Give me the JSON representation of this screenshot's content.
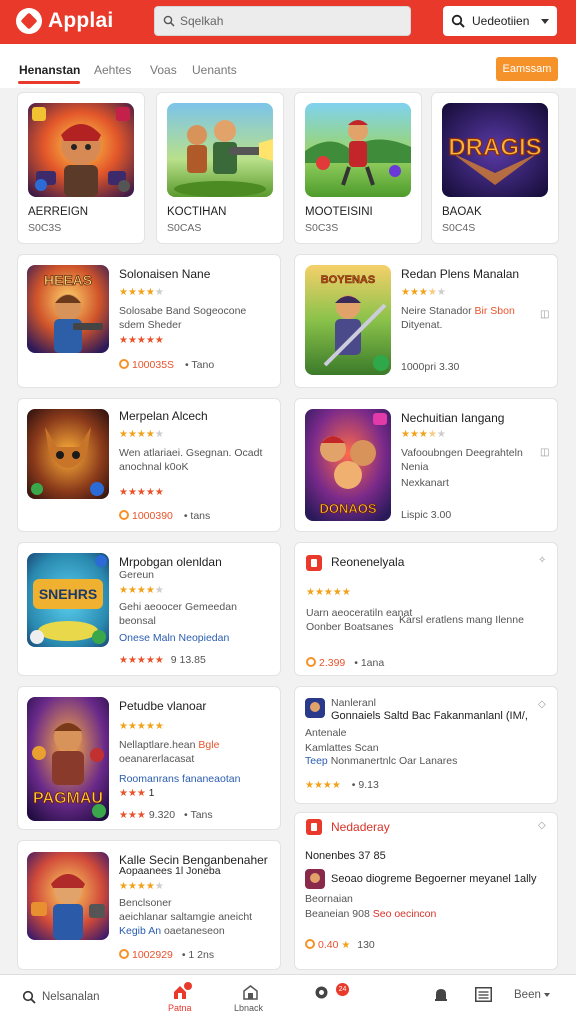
{
  "header": {
    "app_name": "Applai",
    "search_placeholder": "Sqelkah",
    "dropdown_label": "Uedeotiien"
  },
  "tabs": [
    {
      "label": "Henanstan",
      "active": true
    },
    {
      "label": "Aehtes"
    },
    {
      "label": "Voas"
    },
    {
      "label": "Uenants"
    }
  ],
  "tabs_button_label": "Eamssam",
  "featured": [
    {
      "title": "AERREIGN",
      "subtitle": "S0C3S",
      "thumb": "hero-warrior-game-art"
    },
    {
      "title": "KOCTIHAN",
      "subtitle": "S0CAS",
      "thumb": "soldiers-battle-game-art"
    },
    {
      "title": "MOOTEISINI",
      "subtitle": "S0C3S",
      "thumb": "archer-field-game-art"
    },
    {
      "title": "BAOAK",
      "subtitle": "S0C4S",
      "thumb": "dragons-logo-game-art",
      "logo_text": "DRAGIS"
    }
  ],
  "list": [
    {
      "title": "Solonaisen Nane",
      "rating": 4,
      "desc": [
        "Solosabe Band Sogeocone",
        "sdem Sheder"
      ],
      "sub_rating": 5,
      "price": "100035S",
      "price_suffix": "Tano",
      "thumb": "hero-gunner-game-art",
      "logo_text": "HEEAS"
    },
    {
      "title": "Redan Plens Manalan",
      "rating": 3.5,
      "desc": [
        "Neire Stanador",
        "Dityenat."
      ],
      "desc_accent": "Bir Sbon",
      "price": "1000pri",
      "price_suffix": "3.30",
      "thumb": "knight-sword-game-art",
      "logo_text": "BOYENAS"
    },
    {
      "title": "Merpelan Alcech",
      "rating": 4,
      "desc": [
        "Wen atlariaei. Gsegnan. Ocadt",
        "anochnal k0oK"
      ],
      "sub_rating": 5,
      "price": "1000390",
      "price_suffix": "tans",
      "thumb": "fox-creature-game-art"
    },
    {
      "title": "Nechuitian Iangang",
      "rating": 3.5,
      "desc": [
        "Vafooubngen Deegrahteln",
        "Nenia",
        "Nexkanart"
      ],
      "price": "Lispic",
      "price_suffix": "3.00",
      "thumb": "monsters-team-game-art",
      "logo_text": "DONAOS"
    },
    {
      "title": "Mrpobgan olenldan",
      "rating": 4,
      "desc": [
        "Gereun",
        "Gehi aeoocer Gemeedan",
        "beonsal"
      ],
      "link": "Onese Maln Neopiedan",
      "sub_rating": 5,
      "price": "9 13.85",
      "thumb": "magic-world-game-art",
      "logo_text": "SNEHRS"
    },
    {
      "title": "Reonenelyala",
      "rating": 5,
      "desc": [
        "Uarn aeoceratiln eanat",
        "Oonber Boatsanes"
      ],
      "desc_side": "Karsl eratlens mang Ilenne",
      "price": "2.399",
      "price_suffix": "1ana"
    },
    {
      "title": "Petudbe vlanoar",
      "rating": 5,
      "desc": [
        "Nellaptlare.hean",
        "oeanarerlacasat"
      ],
      "desc_accent": "Bgle",
      "link": "Roomanrans fananeaotan",
      "sub_rating": 3,
      "price": "9.320",
      "price_suffix": "Tans",
      "thumb": "barbarian-game-art",
      "logo_text": "PAGMAU"
    },
    {
      "title": "Nanleranl",
      "subtitle": "Gonnaiels Saltd Bac Fakanmanlanl (IM/,",
      "desc": [
        "Antenale",
        "Kamlattes Scan",
        "Nonmanertnlc Oar Lanares"
      ],
      "link": "Teep",
      "rating": 4,
      "price_suffix": "9.13"
    },
    {
      "title": "Kalle Secin Benganbenaher",
      "title2": "Aopaanees 1l Joneba",
      "rating": 4,
      "desc": [
        "Benclsoner",
        "aeichlanar saltamgie aneicht",
        "oaetaneseon"
      ],
      "link": "Kegib An",
      "price": "1002929",
      "price_suffix": "1 2ns",
      "thumb": "pirate-game-art"
    },
    {
      "title": "Nedaderay",
      "section_label": "Nonenbes 37 85",
      "desc": [
        "Seoao diogreme Begoerner meyanel 1ally",
        "Beornaian"
      ],
      "accent_label": "Beaneian 908",
      "accent_value": "Seo oecincon",
      "price": "0.40",
      "price_suffix": "130"
    }
  ],
  "bottom_nav": [
    {
      "label": "Nelsanalan",
      "icon": "search-icon"
    },
    {
      "label": "Patna",
      "icon": "home-icon",
      "active": true
    },
    {
      "label": "Lbnack",
      "icon": "library-icon"
    },
    {
      "label": "",
      "icon": "notifications-icon",
      "badge": "24"
    },
    {
      "label": "",
      "icon": "bell-icon"
    },
    {
      "label": "",
      "icon": "list-icon"
    },
    {
      "label": "Been",
      "icon": "more-icon"
    }
  ]
}
